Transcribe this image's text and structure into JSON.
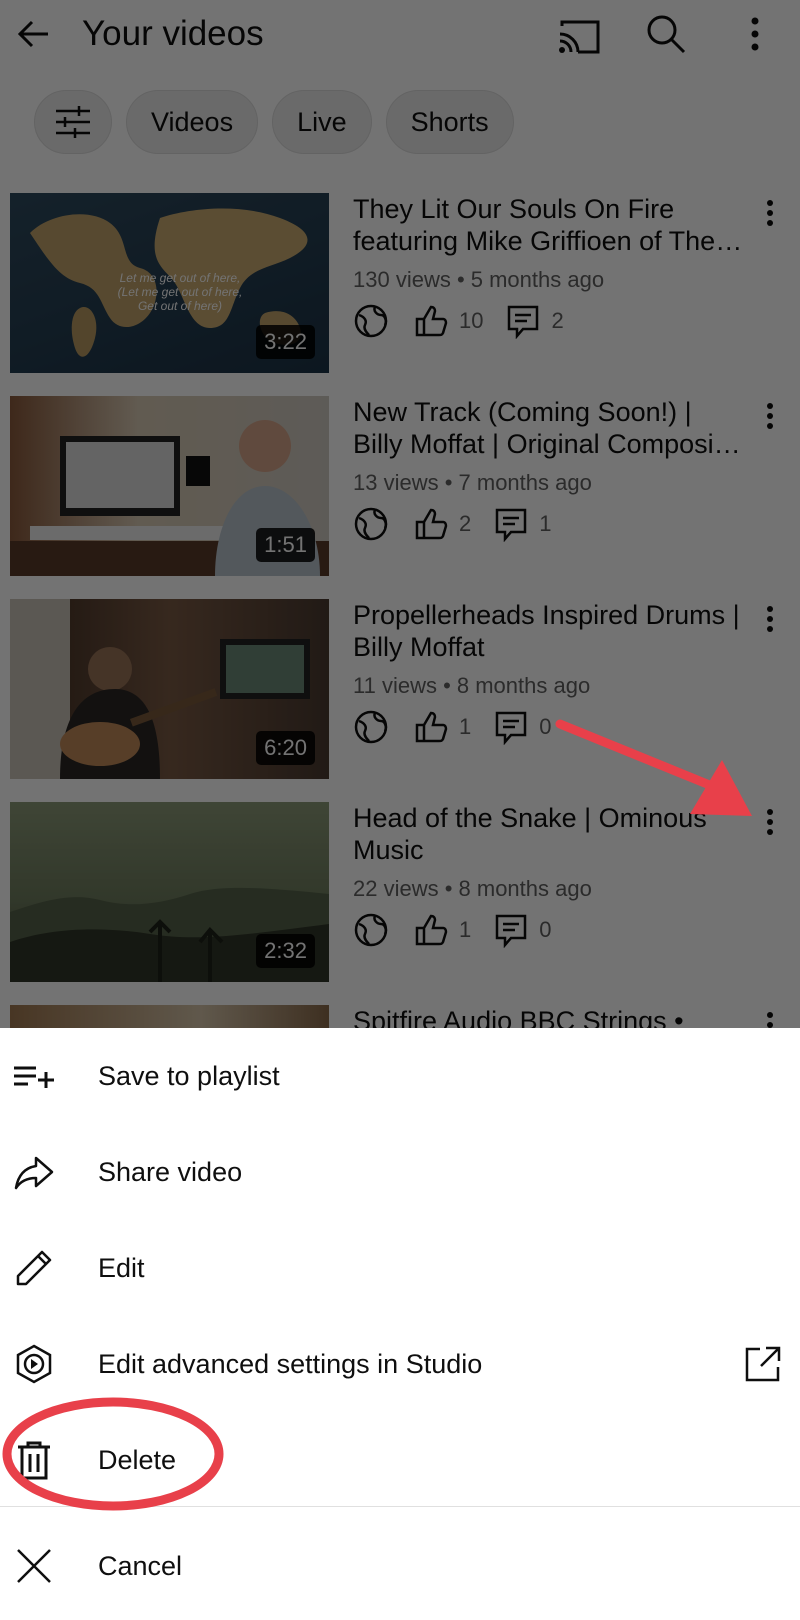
{
  "header": {
    "title": "Your videos",
    "icons": [
      "back-arrow-icon",
      "cast-icon",
      "search-icon",
      "more-vertical-icon"
    ]
  },
  "chips": [
    {
      "label": "",
      "icon": "filter-icon"
    },
    {
      "label": "Videos"
    },
    {
      "label": "Live"
    },
    {
      "label": "Shorts"
    }
  ],
  "videos": [
    {
      "title_line1": "They Lit Our Souls On Fire",
      "title_line2": "featuring Mike Griffioen of The…",
      "meta": "130 views • 5 months ago",
      "likes": "10",
      "comments": "2",
      "duration": "3:22",
      "thumb_overlay_text": "Let me get out of here, (Let me get out of here, Get out of here)"
    },
    {
      "title_line1": "New Track (Coming Soon!) |",
      "title_line2": "Billy Moffat | Original Composi…",
      "meta": "13 views • 7 months ago",
      "likes": "2",
      "comments": "1",
      "duration": "1:51"
    },
    {
      "title_line1": "Propellerheads Inspired Drums |",
      "title_line2": "Billy Moffat",
      "meta": "11 views • 8 months ago",
      "likes": "1",
      "comments": "0",
      "duration": "6:20"
    },
    {
      "title_line1": "Head of the Snake | Ominous",
      "title_line2": "Music",
      "meta": "22 views • 8 months ago",
      "likes": "1",
      "comments": "0",
      "duration": "2:32"
    },
    {
      "title_line1": "Spitfire Audio BBC Strings •"
    }
  ],
  "menu": {
    "items": [
      {
        "label": "Save to playlist",
        "icon": "playlist-add-icon"
      },
      {
        "label": "Share video",
        "icon": "share-icon"
      },
      {
        "label": "Edit",
        "icon": "pencil-icon"
      },
      {
        "label": "Edit advanced settings in Studio",
        "icon": "studio-icon",
        "trailing_icon": "open-external-icon"
      },
      {
        "label": "Delete",
        "icon": "trash-icon"
      }
    ],
    "cancel": {
      "label": "Cancel",
      "icon": "close-icon"
    }
  },
  "colors": {
    "annotation": "#e8404a",
    "overlay": "rgba(0,0,0,0.55)"
  }
}
